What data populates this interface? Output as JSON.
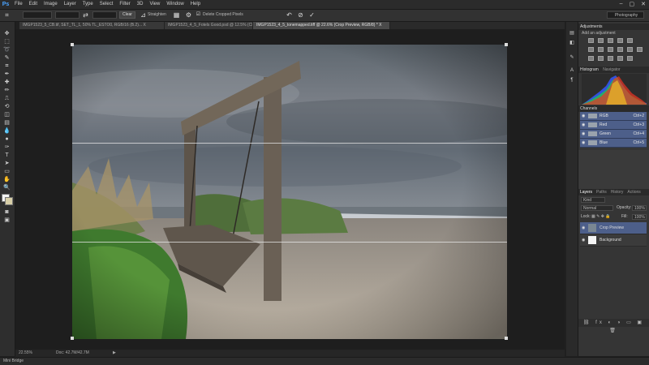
{
  "app": {
    "logo": "Ps"
  },
  "menu": [
    "File",
    "Edit",
    "Image",
    "Layer",
    "Type",
    "Select",
    "Filter",
    "3D",
    "View",
    "Window",
    "Help"
  ],
  "window_controls": [
    "–",
    "▢",
    "✕"
  ],
  "options": {
    "size_field": "",
    "clear_label": "Clear",
    "straighten_label": "Straighten",
    "delete_cropped_label": "Delete Cropped Pixels",
    "workspace": "Photography"
  },
  "tabs": [
    {
      "label": "IMGP1523_5_CB.tif, SET_TL_1, 50% TL_ESTO0, RGB/16 (B.2)... X",
      "active": false
    },
    {
      "label": "IMGP1523_4_5_Fotels Good.psd @ 12.5% (CB RGB/16*) X",
      "active": false
    },
    {
      "label": "IMGP1523_4_5_tonemapped.tiff @ 22.6% (Crop Preview, RGB/8) * X",
      "active": true
    }
  ],
  "status": {
    "zoom": "22.55%",
    "doc": "Doc: 42.7M/42.7M",
    "arrow": "▶"
  },
  "minibridge": {
    "label": "Mini Bridge"
  },
  "adjustments": {
    "tab": "Adjustments",
    "subtitle": "Add an adjustment"
  },
  "histogram": {
    "tab_active": "Histogram",
    "tab_other": "Navigator"
  },
  "channels": {
    "tab": "Channels",
    "rows": [
      {
        "name": "RGB",
        "shortcut": "Ctrl+2"
      },
      {
        "name": "Red",
        "shortcut": "Ctrl+3"
      },
      {
        "name": "Green",
        "shortcut": "Ctrl+4"
      },
      {
        "name": "Blue",
        "shortcut": "Ctrl+5"
      }
    ]
  },
  "layers": {
    "tabs": [
      "Layers",
      "Paths",
      "History",
      "Actions"
    ],
    "kind": "Kind",
    "blend": "Normal",
    "opacity_label": "Opacity:",
    "opacity": "100%",
    "lock_label": "Lock:",
    "fill_label": "Fill:",
    "fill": "100%",
    "rows": [
      {
        "name": "Crop Preview",
        "selected": true
      },
      {
        "name": "Background",
        "selected": false
      }
    ]
  },
  "colors": {
    "accent": "#4d5f8a",
    "panel": "#353535",
    "canvas_bg": "#1e1e1e"
  }
}
